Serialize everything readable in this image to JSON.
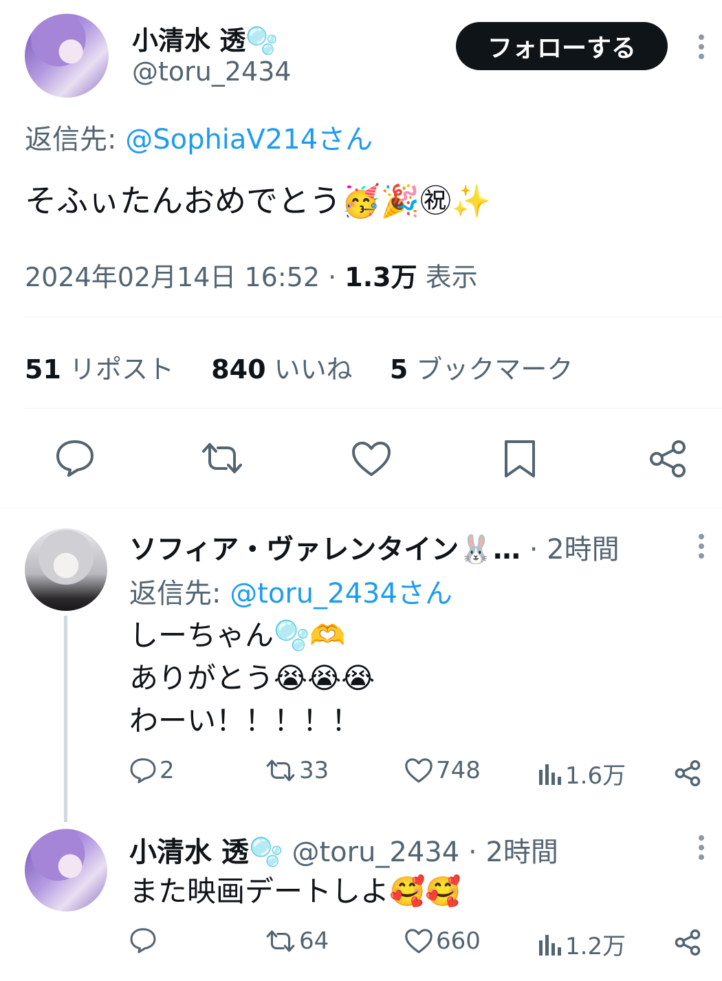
{
  "main_tweet": {
    "display_name": "小清水 透",
    "name_emoji": "🫧",
    "handle": "@toru_2434",
    "follow_label": "フォローする",
    "reply_to_label": "返信先:",
    "reply_to_user": "@SophiaV214さん",
    "text": "そふぃたんおめでとう",
    "text_emojis": "🥳🎉㊗✨",
    "datetime": "2024年02月14日 16:52",
    "views_count": "1.3万",
    "views_label": "表示",
    "reposts_count": "51",
    "reposts_label": "リポスト",
    "likes_count": "840",
    "likes_label": "いいね",
    "bookmarks_count": "5",
    "bookmarks_label": "ブックマーク"
  },
  "reply1": {
    "display_name": "ソフィア・ヴァレンタイン🐰…",
    "time": "· 2時間",
    "reply_to_label": "返信先:",
    "reply_to_user": "@toru_2434さん",
    "line1": "しーちゃん🫧🫶",
    "line2": "ありがとう😭😭😭",
    "line3": "わーい！！！！！",
    "replies": "2",
    "reposts": "33",
    "likes": "748",
    "views": "1.6万"
  },
  "reply2": {
    "display_name": "小清水 透",
    "name_emoji": "🫧",
    "handle": "@toru_2434",
    "time": "· 2時間",
    "text": "また映画デートしよ🥰🥰",
    "replies": "",
    "reposts": "64",
    "likes": "660",
    "views": "1.2万"
  },
  "colors": {
    "text": "#0f1419",
    "secondary": "#536471",
    "link": "#1d9bf0",
    "button_bg": "#0f1419"
  }
}
